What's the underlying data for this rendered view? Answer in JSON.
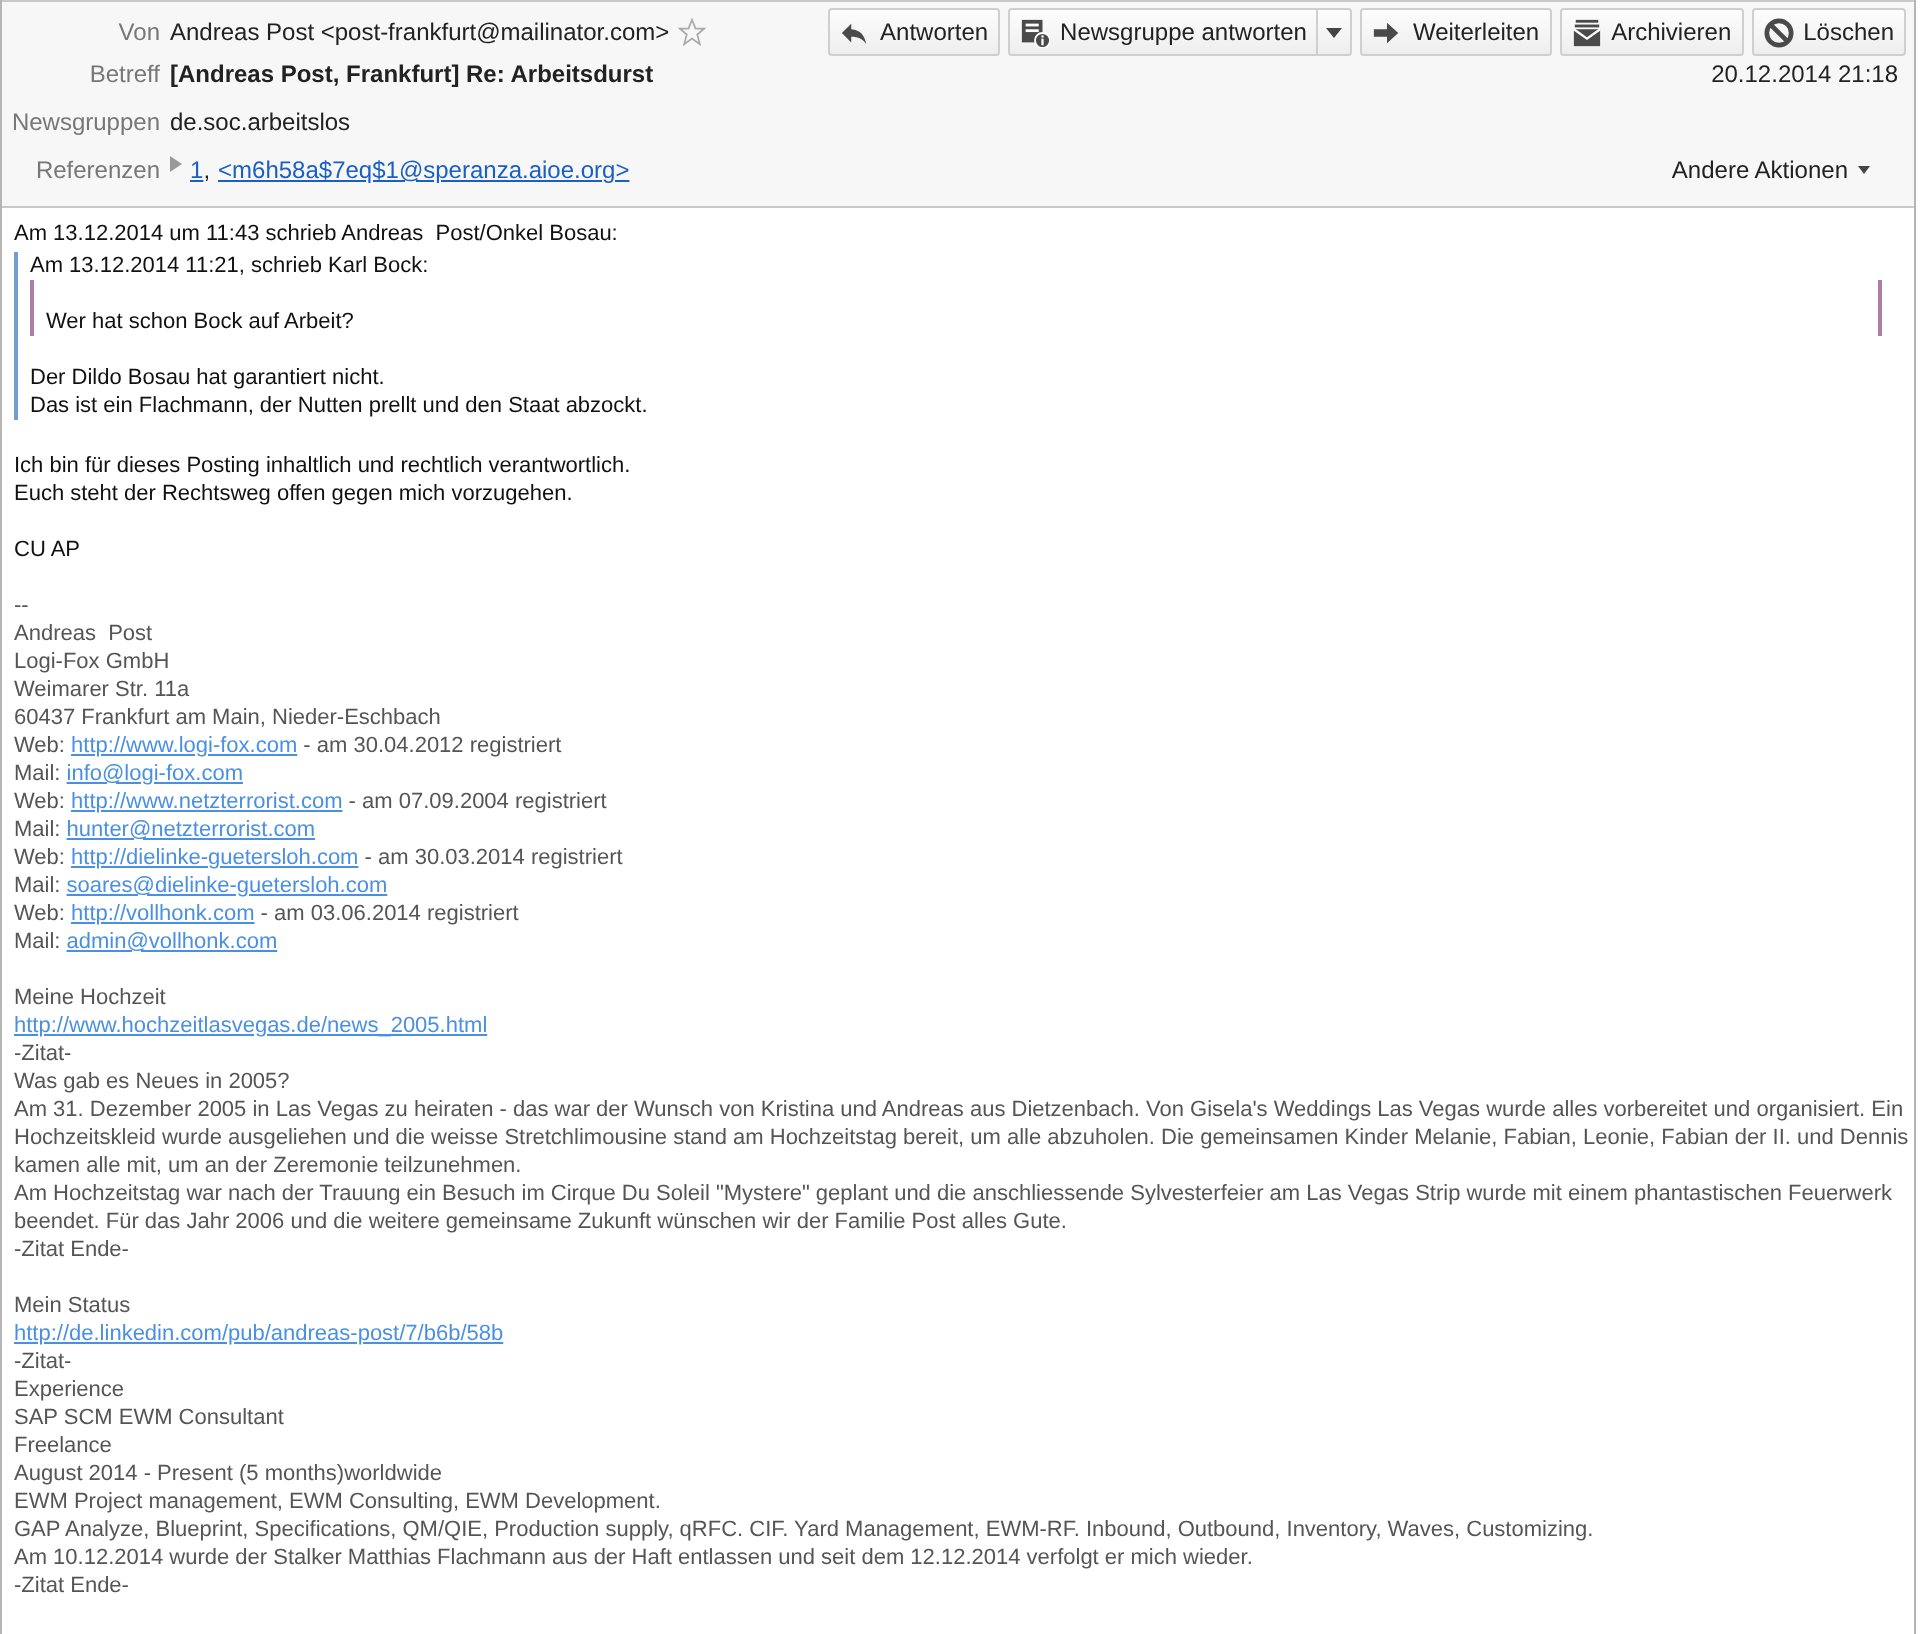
{
  "header": {
    "fields": [
      {
        "label": "Von",
        "kind": "sender",
        "value": "Andreas Post <post-frankfurt@mailinator.com>",
        "starred": false
      },
      {
        "label": "Betreff",
        "kind": "subject",
        "value": "[Andreas Post, Frankfurt] Re: Arbeitsdurst"
      },
      {
        "label": "Newsgruppen",
        "kind": "plain",
        "value": "de.soc.arbeitslos"
      },
      {
        "label": "Referenzen",
        "kind": "references",
        "expanded": false,
        "parts": [
          {
            "kind": "link",
            "text": "1"
          },
          {
            "kind": "text",
            "text": ","
          },
          {
            "kind": "link",
            "text": "<m6h58a$7eq$1@speranza.aioe.org>"
          }
        ]
      }
    ],
    "toolbar": [
      {
        "label": "Antworten",
        "dropdown": false
      },
      {
        "label": "Newsgruppe antworten",
        "dropdown": true
      },
      {
        "label": "Weiterleiten",
        "dropdown": false
      },
      {
        "label": "Archivieren",
        "dropdown": false
      },
      {
        "label": "Löschen",
        "dropdown": false
      }
    ],
    "date": "20.12.2014 21:18",
    "other_actions": "Andere Aktionen"
  },
  "body": {
    "message": [
      {
        "kind": "line",
        "text": "Am 13.12.2014 um 11:43 schrieb Andreas  Post/Onkel Bosau:"
      },
      {
        "kind": "quote",
        "children": [
          {
            "kind": "line",
            "text": "Am 13.12.2014 11:21, schrieb Karl Bock:"
          },
          {
            "kind": "quote",
            "children": [
              {
                "kind": "gap"
              },
              {
                "kind": "line",
                "text": "Wer hat schon Bock auf Arbeit?"
              }
            ]
          },
          {
            "kind": "gap"
          },
          {
            "kind": "line",
            "text": "Der Dildo Bosau hat garantiert nicht."
          },
          {
            "kind": "line",
            "text": "Das ist ein Flachmann, der Nutten prellt und den Staat abzockt."
          }
        ]
      },
      {
        "kind": "gap"
      },
      {
        "kind": "line",
        "text": "Ich bin für dieses Posting inhaltlich und rechtlich verantwortlich."
      },
      {
        "kind": "line",
        "text": "Euch steht der Rechtsweg offen gegen mich vorzugehen."
      },
      {
        "kind": "gap"
      },
      {
        "kind": "line",
        "text": "CU AP"
      },
      {
        "kind": "gap"
      }
    ],
    "signature": [
      {
        "kind": "line",
        "text": "--"
      },
      {
        "kind": "line",
        "text": "Andreas  Post"
      },
      {
        "kind": "line",
        "text": "Logi-Fox GmbH"
      },
      {
        "kind": "line",
        "text": "Weimarer Str. 11a"
      },
      {
        "kind": "line",
        "text": "60437 Frankfurt am Main, Nieder-Eschbach"
      },
      {
        "kind": "line",
        "parts": [
          {
            "kind": "text",
            "text": "Web: "
          },
          {
            "kind": "link",
            "text": "http://www.logi-fox.com"
          },
          {
            "kind": "text",
            "text": " - am 30.04.2012 registriert"
          }
        ]
      },
      {
        "kind": "line",
        "parts": [
          {
            "kind": "text",
            "text": "Mail: "
          },
          {
            "kind": "link",
            "text": "info@logi-fox.com"
          }
        ]
      },
      {
        "kind": "line",
        "parts": [
          {
            "kind": "text",
            "text": "Web: "
          },
          {
            "kind": "link",
            "text": "http://www.netzterrorist.com"
          },
          {
            "kind": "text",
            "text": " - am 07.09.2004 registriert"
          }
        ]
      },
      {
        "kind": "line",
        "parts": [
          {
            "kind": "text",
            "text": "Mail: "
          },
          {
            "kind": "link",
            "text": "hunter@netzterrorist.com"
          }
        ]
      },
      {
        "kind": "line",
        "parts": [
          {
            "kind": "text",
            "text": "Web: "
          },
          {
            "kind": "link",
            "text": "http://dielinke-guetersloh.com"
          },
          {
            "kind": "text",
            "text": " - am 30.03.2014 registriert"
          }
        ]
      },
      {
        "kind": "line",
        "parts": [
          {
            "kind": "text",
            "text": "Mail: "
          },
          {
            "kind": "link",
            "text": "soares@dielinke-guetersloh.com"
          }
        ]
      },
      {
        "kind": "line",
        "parts": [
          {
            "kind": "text",
            "text": "Web: "
          },
          {
            "kind": "link",
            "text": "http://vollhonk.com"
          },
          {
            "kind": "text",
            "text": " - am 03.06.2014 registriert"
          }
        ]
      },
      {
        "kind": "line",
        "parts": [
          {
            "kind": "text",
            "text": "Mail: "
          },
          {
            "kind": "link",
            "text": "admin@vollhonk.com"
          }
        ]
      },
      {
        "kind": "gap"
      },
      {
        "kind": "line",
        "text": "Meine Hochzeit"
      },
      {
        "kind": "line",
        "parts": [
          {
            "kind": "link",
            "text": "http://www.hochzeitlasvegas.de/news_2005.html"
          }
        ]
      },
      {
        "kind": "line",
        "text": "-Zitat-"
      },
      {
        "kind": "line",
        "text": "Was gab es Neues in 2005?"
      },
      {
        "kind": "line",
        "text": "Am 31. Dezember 2005 in Las Vegas zu heiraten - das war der Wunsch von Kristina und Andreas aus Dietzenbach. Von Gisela's Weddings Las Vegas wurde alles vorbereitet und organisiert. Ein"
      },
      {
        "kind": "line",
        "text": "Hochzeitskleid wurde ausgeliehen und die weisse Stretchlimousine stand am Hochzeitstag bereit, um alle abzuholen. Die gemeinsamen Kinder Melanie, Fabian, Leonie, Fabian der II. und Dennis"
      },
      {
        "kind": "line",
        "text": "kamen alle mit, um an der Zeremonie teilzunehmen."
      },
      {
        "kind": "line",
        "text": "Am Hochzeitstag war nach der Trauung ein Besuch im Cirque Du Soleil \"Mystere\" geplant und die anschliessende Sylvesterfeier am Las Vegas Strip wurde mit einem phantastischen Feuerwerk"
      },
      {
        "kind": "line",
        "text": "beendet. Für das Jahr 2006 und die weitere gemeinsame Zukunft wünschen wir der Familie Post alles Gute."
      },
      {
        "kind": "line",
        "text": "-Zitat Ende-"
      },
      {
        "kind": "gap"
      },
      {
        "kind": "line",
        "text": "Mein Status"
      },
      {
        "kind": "line",
        "parts": [
          {
            "kind": "link",
            "text": "http://de.linkedin.com/pub/andreas-post/7/b6b/58b"
          }
        ]
      },
      {
        "kind": "line",
        "text": "-Zitat-"
      },
      {
        "kind": "line",
        "text": "Experience"
      },
      {
        "kind": "line",
        "text": "SAP SCM EWM Consultant"
      },
      {
        "kind": "line",
        "text": "Freelance"
      },
      {
        "kind": "line",
        "text": "August 2014 - Present (5 months)worldwide"
      },
      {
        "kind": "line",
        "text": "EWM Project management, EWM Consulting, EWM Development."
      },
      {
        "kind": "line",
        "text": "GAP Analyze, Blueprint, Specifications, QM/QIE, Production supply, qRFC. CIF. Yard Management, EWM-RF. Inbound, Outbound, Inventory, Waves, Customizing."
      },
      {
        "kind": "line",
        "text": "Am 10.12.2014 wurde der Stalker Matthias Flachmann aus der Haft entlassen und seit dem 12.12.2014 verfolgt er mich wieder."
      },
      {
        "kind": "line",
        "text": "-Zitat Ende-"
      }
    ]
  }
}
